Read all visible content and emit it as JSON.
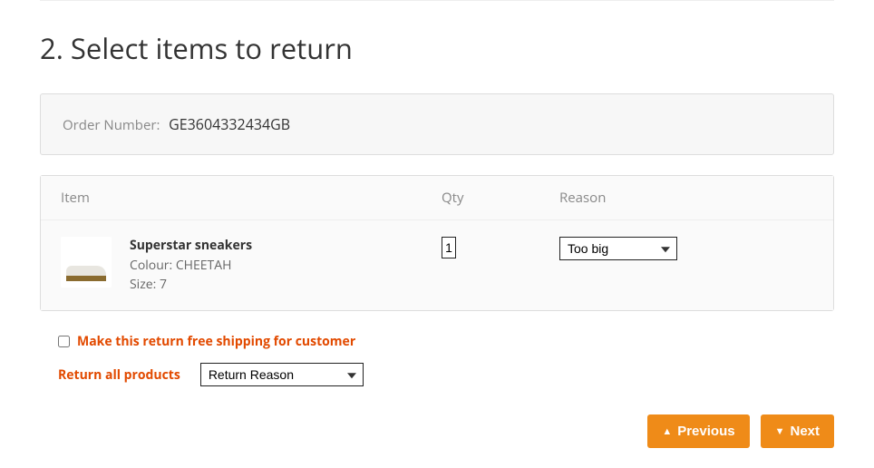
{
  "step": {
    "title": "2. Select items to return"
  },
  "order": {
    "label": "Order Number:",
    "number": "GE3604332434GB"
  },
  "columns": {
    "item": "Item",
    "qty": "Qty",
    "reason": "Reason"
  },
  "product": {
    "name": "Superstar sneakers",
    "colour_label": "Colour:",
    "colour": "CHEETAH",
    "size_label": "Size:",
    "size": "7",
    "qty": "1",
    "reason": "Too big"
  },
  "controls": {
    "free_shipping": "Make this return free shipping for customer",
    "return_all_label": "Return all products",
    "return_all_placeholder": "Return Reason"
  },
  "nav": {
    "previous": "Previous",
    "next": "Next"
  }
}
